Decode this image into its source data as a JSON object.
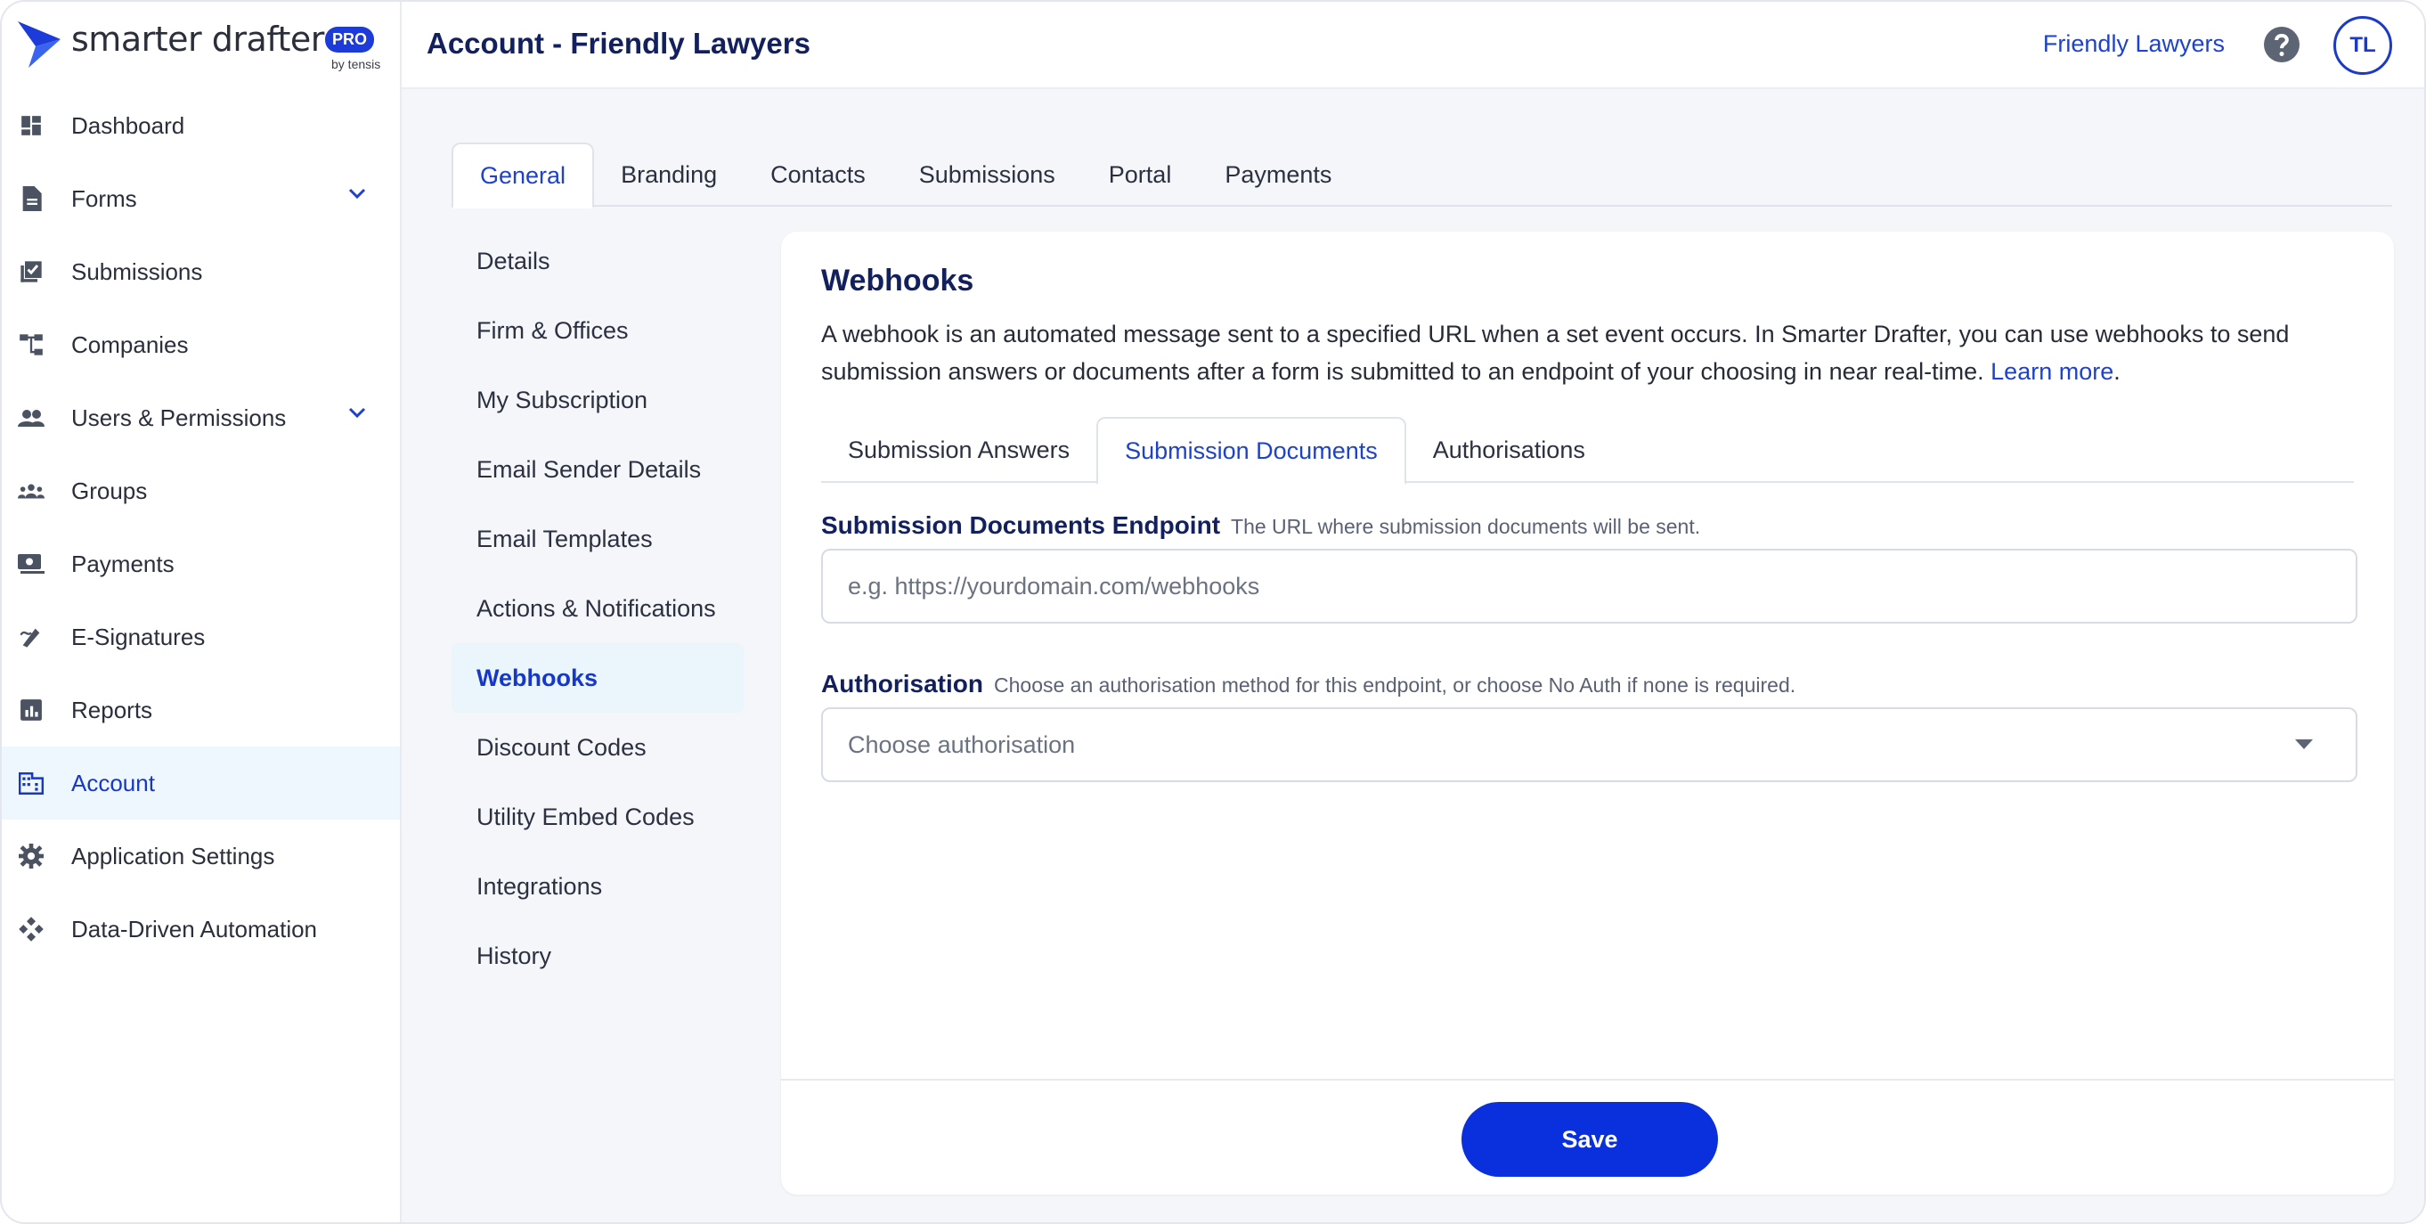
{
  "app": {
    "brand": "smarter drafter",
    "badge": "PRO",
    "by": "by tensis"
  },
  "header": {
    "title": "Account - Friendly Lawyers",
    "org": "Friendly Lawyers",
    "avatar": "TL"
  },
  "sidebar": {
    "items": [
      {
        "label": "Dashboard",
        "icon": "dashboard-icon"
      },
      {
        "label": "Forms",
        "icon": "document-icon",
        "expandable": true
      },
      {
        "label": "Submissions",
        "icon": "checklist-icon"
      },
      {
        "label": "Companies",
        "icon": "hierarchy-icon"
      },
      {
        "label": "Users & Permissions",
        "icon": "users-icon",
        "expandable": true
      },
      {
        "label": "Groups",
        "icon": "group-icon"
      },
      {
        "label": "Payments",
        "icon": "money-icon"
      },
      {
        "label": "E-Signatures",
        "icon": "signature-icon"
      },
      {
        "label": "Reports",
        "icon": "report-icon"
      },
      {
        "label": "Account",
        "icon": "building-icon",
        "active": true
      },
      {
        "label": "Application Settings",
        "icon": "gear-icon"
      },
      {
        "label": "Data-Driven Automation",
        "icon": "automation-icon"
      }
    ]
  },
  "tabs": [
    "General",
    "Branding",
    "Contacts",
    "Submissions",
    "Portal",
    "Payments"
  ],
  "subnav": [
    "Details",
    "Firm & Offices",
    "My Subscription",
    "Email Sender Details",
    "Email Templates",
    "Actions & Notifications",
    "Webhooks",
    "Discount Codes",
    "Utility Embed Codes",
    "Integrations",
    "History"
  ],
  "card": {
    "title": "Webhooks",
    "description": "A webhook is an automated message sent to a specified URL when a set event occurs. In Smarter Drafter, you can use webhooks to send submission answers or documents after a form is submitted to an endpoint of your choosing in near real-time.",
    "learn_more": "Learn more",
    "tabs": [
      "Submission Answers",
      "Submission Documents",
      "Authorisations"
    ],
    "endpoint": {
      "label": "Submission Documents Endpoint",
      "hint": "The URL where submission documents will be sent.",
      "placeholder": "e.g. https://yourdomain.com/webhooks",
      "value": ""
    },
    "auth": {
      "label": "Authorisation",
      "hint": "Choose an authorisation method for this endpoint, or choose No Auth if none is required.",
      "placeholder": "Choose authorisation"
    },
    "save_label": "Save"
  },
  "colors": {
    "accent": "#1e42c9",
    "navy": "#13205e",
    "save": "#0a30dd",
    "active_bg": "#eef7fd"
  }
}
